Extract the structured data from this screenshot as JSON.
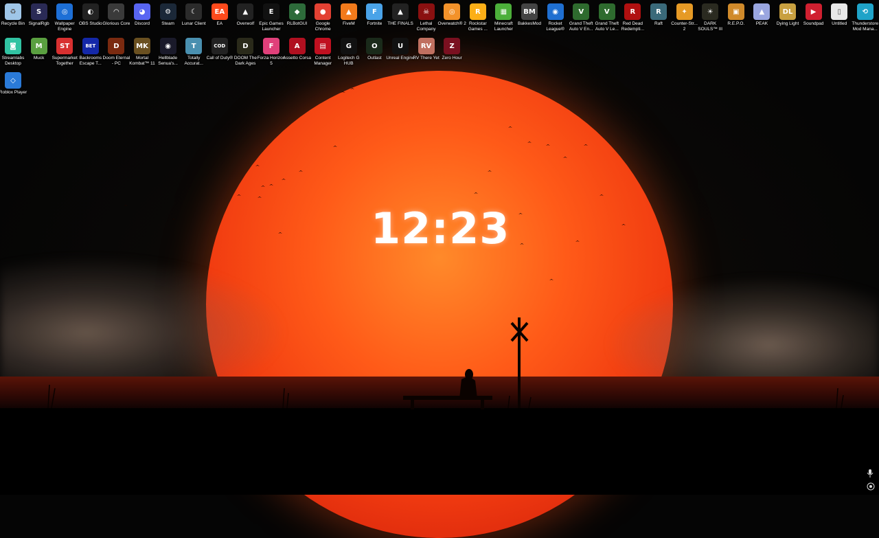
{
  "clock": {
    "time": "12:23"
  },
  "desktop_icons": [
    {
      "label": "Recycle Bin",
      "name": "recycle-bin-icon",
      "glyph": "♻",
      "color": "#9fc6e8"
    },
    {
      "label": "SignalRgb",
      "name": "signalrgb-icon",
      "glyph": "S",
      "color": "#2a2a55"
    },
    {
      "label": "Wallpaper Engine",
      "name": "wallpaper-engine-icon",
      "glyph": "◎",
      "color": "#1d6fd6"
    },
    {
      "label": "OBS Studio",
      "name": "obs-studio-icon",
      "glyph": "◐",
      "color": "#222"
    },
    {
      "label": "Glorious Core",
      "name": "glorious-core-icon",
      "glyph": "◠",
      "color": "#3a3a3a"
    },
    {
      "label": "Discord",
      "name": "discord-icon",
      "glyph": "◕",
      "color": "#5865f2"
    },
    {
      "label": "Steam",
      "name": "steam-icon",
      "glyph": "⚙",
      "color": "#1b2838"
    },
    {
      "label": "Lunar Client",
      "name": "lunar-client-icon",
      "glyph": "☾",
      "color": "#2b2b2b"
    },
    {
      "label": "EA",
      "name": "ea-icon",
      "glyph": "EA",
      "color": "#ff4a1c"
    },
    {
      "label": "Overwolf",
      "name": "overwolf-icon",
      "glyph": "▲",
      "color": "#222"
    },
    {
      "label": "Epic Games Launcher",
      "name": "epic-games-icon",
      "glyph": "E",
      "color": "#111"
    },
    {
      "label": "RLBotGUI",
      "name": "rlbotgui-icon",
      "glyph": "◆",
      "color": "#2d6b3a"
    },
    {
      "label": "Google Chrome",
      "name": "chrome-icon",
      "glyph": "●",
      "color": "#e34133"
    },
    {
      "label": "FiveM",
      "name": "fivem-icon",
      "glyph": "▲",
      "color": "#f27a1b"
    },
    {
      "label": "Fortnite",
      "name": "fortnite-icon",
      "glyph": "F",
      "color": "#4aa3e8"
    },
    {
      "label": "THE FINALS",
      "name": "the-finals-icon",
      "glyph": "▲",
      "color": "#222"
    },
    {
      "label": "Lethal Company",
      "name": "lethal-company-icon",
      "glyph": "☠",
      "color": "#8a1010"
    },
    {
      "label": "Overwatch® 2",
      "name": "overwatch-icon",
      "glyph": "◎",
      "color": "#f3922a"
    },
    {
      "label": "Rockstar Games ...",
      "name": "rockstar-icon",
      "glyph": "R",
      "color": "#fcaf17"
    },
    {
      "label": "Minecraft Launcher",
      "name": "minecraft-icon",
      "glyph": "▦",
      "color": "#4caf3a"
    },
    {
      "label": "BakkesMod",
      "name": "bakkesmod-icon",
      "glyph": "BM",
      "color": "#444"
    },
    {
      "label": "Rocket League®",
      "name": "rocket-league-icon",
      "glyph": "◉",
      "color": "#1f6fd0"
    },
    {
      "label": "Grand Theft Auto V En...",
      "name": "gta-v-enhanced-icon",
      "glyph": "V",
      "color": "#2e6b2e"
    },
    {
      "label": "Grand Theft Auto V Le...",
      "name": "gta-v-legacy-icon",
      "glyph": "V",
      "color": "#2e6b2e"
    },
    {
      "label": "Red Dead Redempti...",
      "name": "red-dead-icon",
      "glyph": "R",
      "color": "#b01010"
    },
    {
      "label": "Raft",
      "name": "raft-icon",
      "glyph": "R",
      "color": "#3a6a7a"
    },
    {
      "label": "Counter-Str... 2",
      "name": "counter-strike-icon",
      "glyph": "✦",
      "color": "#e69a25"
    },
    {
      "label": "DARK SOULS™ III",
      "name": "dark-souls-icon",
      "glyph": "☀",
      "color": "#2a2a20"
    },
    {
      "label": "R.E.P.O.",
      "name": "repo-icon",
      "glyph": "▣",
      "color": "#d08a2a"
    },
    {
      "label": "PEAK",
      "name": "peak-icon",
      "glyph": "▲",
      "color": "#9aa6e0"
    },
    {
      "label": "Dying Light",
      "name": "dying-light-icon",
      "glyph": "DL",
      "color": "#c8a040"
    },
    {
      "label": "Soundpad",
      "name": "soundpad-icon",
      "glyph": "▶",
      "color": "#d02030"
    },
    {
      "label": "Untitled",
      "name": "untitled-file-icon",
      "glyph": "▯",
      "color": "#e8e8e8"
    },
    {
      "label": "Thunderstore Mod Mana...",
      "name": "thunderstore-icon",
      "glyph": "⟲",
      "color": "#1fa3c8"
    },
    {
      "label": "Streamlabs Desktop",
      "name": "streamlabs-icon",
      "glyph": "◙",
      "color": "#31c3a2"
    },
    {
      "label": "Muck",
      "name": "muck-icon",
      "glyph": "M",
      "color": "#5aa040"
    },
    {
      "label": "Supermarket Together",
      "name": "supermarket-together-icon",
      "glyph": "ST",
      "color": "#d83030"
    },
    {
      "label": "Backrooms Escape T...",
      "name": "backrooms-icon",
      "glyph": "BET",
      "color": "#1428a8"
    },
    {
      "label": "Doom Eternal - PC",
      "name": "doom-eternal-icon",
      "glyph": "D",
      "color": "#7a2a10"
    },
    {
      "label": "Mortal Kombat™ 11",
      "name": "mortal-kombat-icon",
      "glyph": "MK",
      "color": "#6a5020"
    },
    {
      "label": "Hellblade Senua's...",
      "name": "hellblade-icon",
      "glyph": "◉",
      "color": "#1a1a2a"
    },
    {
      "label": "Totally Accurat...",
      "name": "tabs-icon",
      "glyph": "T",
      "color": "#4a90b0"
    },
    {
      "label": "Call of Duty®",
      "name": "call-of-duty-icon",
      "glyph": "COD",
      "color": "#222"
    },
    {
      "label": "DOOM The Dark Ages",
      "name": "doom-dark-ages-icon",
      "glyph": "D",
      "color": "#2a2a1a"
    },
    {
      "label": "Forza Horizon 5",
      "name": "forza-icon",
      "glyph": "F",
      "color": "#e0407a"
    },
    {
      "label": "Assetto Corsa",
      "name": "assetto-corsa-icon",
      "glyph": "A",
      "color": "#b01020"
    },
    {
      "label": "Content Manager",
      "name": "content-manager-icon",
      "glyph": "▤",
      "color": "#c01020"
    },
    {
      "label": "Logitech G HUB",
      "name": "logitech-icon",
      "glyph": "G",
      "color": "#111"
    },
    {
      "label": "Outlast",
      "name": "outlast-icon",
      "glyph": "O",
      "color": "#1a2a1a"
    },
    {
      "label": "Unreal Engine",
      "name": "unreal-engine-icon",
      "glyph": "U",
      "color": "#111"
    },
    {
      "label": "RV There Yet",
      "name": "rv-there-yet-icon",
      "glyph": "RV",
      "color": "#c07060"
    },
    {
      "label": "Zero Hour",
      "name": "zero-hour-icon",
      "glyph": "Z",
      "color": "#7a1020"
    },
    {
      "label": "Roblox Player",
      "name": "roblox-icon",
      "glyph": "◇",
      "color": "#2a7ad8"
    }
  ],
  "colors": {
    "sun": "#ff5a18",
    "label_text": "#ffffff"
  }
}
